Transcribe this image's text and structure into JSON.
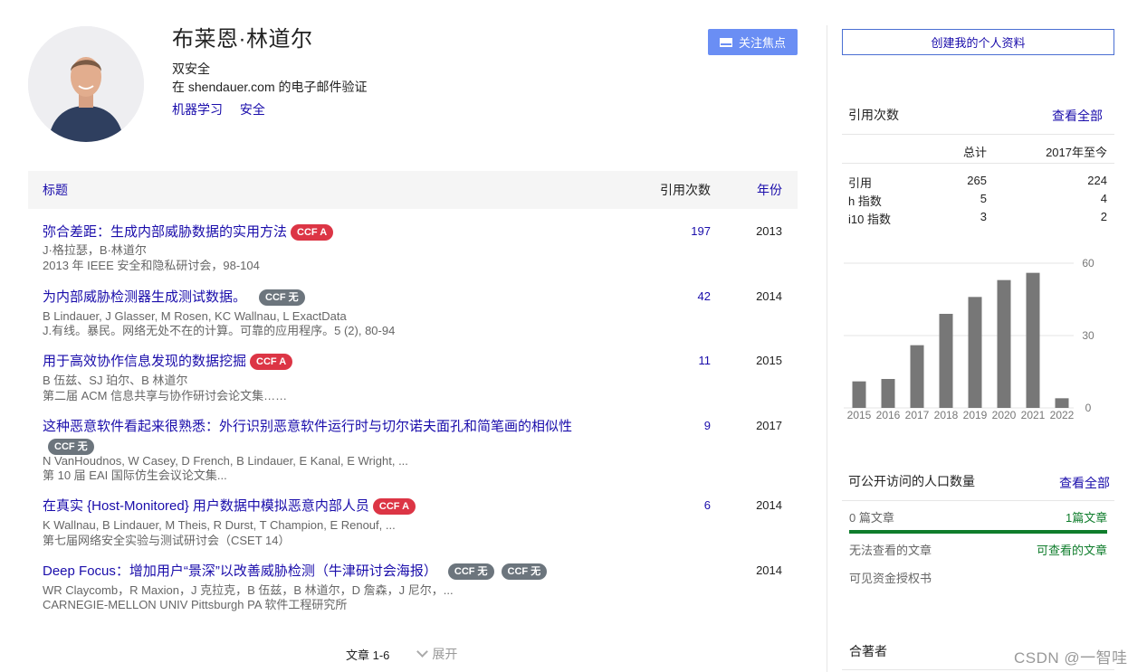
{
  "profile": {
    "name": "布莱恩·林道尔",
    "affiliation": "双安全",
    "email_line": "在 shendauer.com 的电子邮件验证",
    "tags": [
      "机器学习",
      "安全"
    ],
    "follow_label": "关注焦点"
  },
  "table": {
    "head_title": "标题",
    "head_cites": "引用次数",
    "head_year": "年份",
    "rows": [
      {
        "title": "弥合差距：生成内部威胁数据的实用方法",
        "badges": [
          {
            "label": "CCF A",
            "color": "#dc3545"
          }
        ],
        "authors": "J·格拉瑟，B·林道尔",
        "venue": "2013 年 IEEE 安全和隐私研讨会，98-104",
        "cites": "197",
        "year": "2013"
      },
      {
        "title": "为内部威胁检测器生成测试数据。",
        "badges": [
          {
            "label": "CCF 无",
            "color": "#6c757d"
          }
        ],
        "authors": "B Lindauer, J Glasser, M Rosen, KC Wallnau, L ExactData",
        "venue": "J.有线。暴民。网络无处不在的计算。可靠的应用程序。5 (2), 80-94",
        "cites": "42",
        "year": "2014"
      },
      {
        "title": "用于高效协作信息发现的数据挖掘",
        "badges": [
          {
            "label": "CCF A",
            "color": "#dc3545"
          }
        ],
        "authors": "B 伍兹、SJ 珀尔、B 林道尔",
        "venue": "第二届 ACM 信息共享与协作研讨会论文集……",
        "cites": "11",
        "year": "2015"
      },
      {
        "title": "这种恶意软件看起来很熟悉：外行识别恶意软件运行时与切尔诺夫面孔和简笔画的相似性",
        "badges": [
          {
            "label": "CCF 无",
            "color": "#6c757d"
          }
        ],
        "authors": "N VanHoudnos, W Casey, D French, B Lindauer, E Kanal, E Wright, ...",
        "venue": "第 10 届 EAI 国际仿生会议论文集...",
        "cites": "9",
        "year": "2017"
      },
      {
        "title": "在真实 {Host-Monitored} 用户数据中模拟恶意内部人员",
        "badges": [
          {
            "label": "CCF A",
            "color": "#dc3545"
          }
        ],
        "authors": "K Wallnau, B Lindauer, M Theis, R Durst, T Champion, E Renouf, ...",
        "venue": "第七届网络安全实验与测试研讨会（CSET 14）",
        "cites": "6",
        "year": "2014"
      },
      {
        "title": "Deep Focus：增加用户“景深”以改善威胁检测（牛津研讨会海报）",
        "badges": [
          {
            "label": "CCF 无",
            "color": "#6c757d"
          },
          {
            "label": "CCF 无",
            "color": "#6c757d"
          }
        ],
        "authors": "WR Claycomb，R Maxion，J 克拉克，B 伍兹，B 林道尔，D 詹森，J 尼尔，...",
        "venue": "CARNEGIE-MELLON UNIV Pittsburgh PA 软件工程研究所",
        "cites": "",
        "year": "2014"
      }
    ],
    "pager_label": "文章 1-6",
    "expand_label": "展开"
  },
  "sidebar": {
    "create_label": "创建我的个人资料",
    "citations_title": "引用次数",
    "view_all": "查看全部",
    "col_total": "总计",
    "col_since": "2017年至今",
    "metrics": [
      {
        "label": "引用",
        "total": "265",
        "since": "224"
      },
      {
        "label": "h 指数",
        "total": "5",
        "since": "4"
      },
      {
        "label": "i10 指数",
        "total": "3",
        "since": "2"
      }
    ],
    "oa_title": "可公开访问的人口数量",
    "oa_view_all": "查看全部",
    "oa_left": "0 篇文章",
    "oa_right": "1篇文章",
    "oa_left_sub": "无法查看的文章",
    "oa_right_sub": "可查看的文章",
    "oa_mandate": "可见资金授权书",
    "coauthors_title": "合著者"
  },
  "chart_data": {
    "type": "bar",
    "categories": [
      "2015",
      "2016",
      "2017",
      "2018",
      "2019",
      "2020",
      "2021",
      "2022"
    ],
    "category_labels": [
      "2015",
      "2016",
      "2017",
      "2018",
      "2019",
      "2020",
      "2021",
      "2022"
    ],
    "values": [
      11,
      12,
      26,
      39,
      46,
      53,
      56,
      4
    ],
    "ylim": [
      0,
      60
    ],
    "yticks": [
      0,
      30,
      60
    ],
    "grid": true,
    "bar_color": "#777777"
  },
  "watermark": "CSDN @一智哇"
}
